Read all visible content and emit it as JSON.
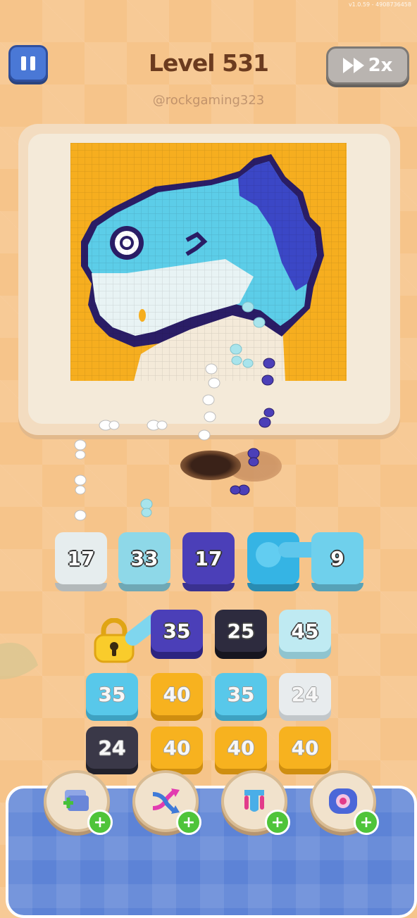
{
  "version": "v1.0.59 - 4908736458",
  "header": {
    "level_title": "Level 531",
    "watermark": "@rockgaming323",
    "speed_label": "2x"
  },
  "palette": {
    "background": "#F6C48A",
    "canvas_yellow": "#F6AE1F",
    "fish_light": "#5CCDE8",
    "fish_mid": "#2FA5DA",
    "fish_dark": "#3D2BA0",
    "belly": "#E8F3F4",
    "outline": "#2A1D66"
  },
  "slots": [
    {
      "count": "17",
      "color": "#E6EDEE"
    },
    {
      "count": "33",
      "color": "#8ED8E8"
    },
    {
      "count": "17",
      "color": "#4B3FB8"
    },
    {
      "count": "",
      "color": "#35B4E4"
    },
    {
      "count": "9",
      "color": "#6FD0EC"
    }
  ],
  "grid": {
    "row1": [
      {
        "count": "35",
        "color": "#4B3FB8"
      },
      {
        "count": "25",
        "color": "#2D2B3E"
      },
      {
        "count": "45",
        "color": "#BFEAF2"
      }
    ],
    "row2": [
      {
        "count": "35",
        "color": "#58C8EA"
      },
      {
        "count": "40",
        "color": "#F7B21F"
      },
      {
        "count": "35",
        "color": "#58C8EA"
      },
      {
        "count": "24",
        "color": "#E8ECEE"
      }
    ],
    "row3": [
      {
        "count": "24",
        "color": "#3A3848"
      },
      {
        "count": "40",
        "color": "#F7B21F"
      },
      {
        "count": "40",
        "color": "#F7B21F"
      },
      {
        "count": "40",
        "color": "#F7B21F"
      }
    ]
  },
  "boosters": [
    "add-slot-icon",
    "shuffle-icon",
    "magnet-icon",
    "hole-icon"
  ]
}
